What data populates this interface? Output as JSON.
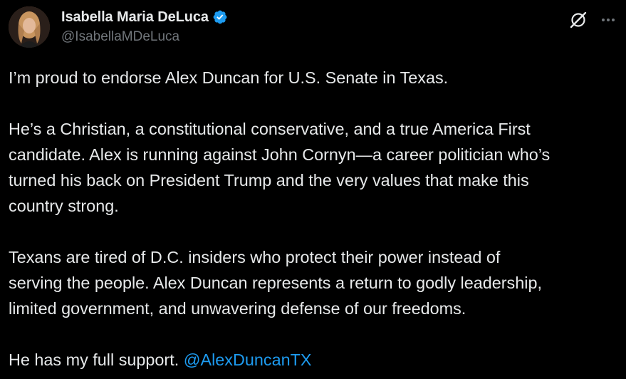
{
  "author": {
    "display_name": "Isabella Maria DeLuca",
    "handle": "@IsabellaMDeLuca",
    "verified": true
  },
  "icons": {
    "avatar": "profile-photo",
    "verified": "verified-badge-icon",
    "grok": "grok-icon",
    "more": "more-options-icon"
  },
  "colors": {
    "background": "#000000",
    "text": "#e7e9ea",
    "secondary": "#71767b",
    "accent": "#1d9bf0"
  },
  "post": {
    "p1": "I’m proud to endorse Alex Duncan for U.S. Senate in Texas.",
    "p2_lines": [
      "He’s a Christian, a constitutional conservative, and a true America First",
      "candidate. Alex is running against John Cornyn—a career politician who’s",
      "turned his back on President Trump and the very values that make this",
      "country strong."
    ],
    "p3_lines": [
      "Texans are tired of D.C. insiders who protect their power instead of",
      "serving the people. Alex Duncan represents a return to godly leadership,",
      "limited government, and unwavering defense of our freedoms."
    ],
    "p4_text": "He has my full support. ",
    "p4_mention": "@AlexDuncanTX"
  }
}
